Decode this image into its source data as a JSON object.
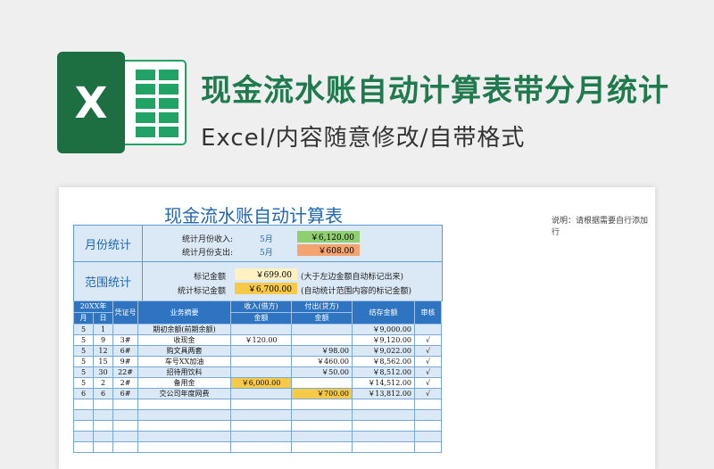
{
  "banner": {
    "title": "现金流水账自动计算表带分月统计",
    "subtitle": "Excel/内容随意修改/自带格式",
    "logo_icon": "excel-icon",
    "logo_letter": "X"
  },
  "sheet": {
    "title": "现金流水账自动计算表",
    "note": "说明：请根据需要自行添加行"
  },
  "monthly": {
    "heading": "月份统计",
    "income_label": "统计月份收入:",
    "income_month": "5月",
    "income_value": "￥6,120.00",
    "expense_label": "统计月份支出:",
    "expense_month": "5月",
    "expense_value": "￥608.00"
  },
  "range": {
    "heading": "范围统计",
    "marked_label": "标记金额",
    "marked_value": "￥699.00",
    "marked_note": "(大于左边金额自动标记出来)",
    "sum_label": "统计标记金额",
    "sum_value": "￥6,700.00",
    "sum_note": "(自动统计范围内容的标记金额)"
  },
  "ledger": {
    "header": {
      "year": "20XX年",
      "month": "月",
      "day": "日",
      "voucher": "凭证号",
      "summary": "业务摘要",
      "income": "收入(借方)",
      "income2": "金额",
      "expense": "付出(贷方)",
      "expense2": "金额",
      "balance": "结存金额",
      "audit": "审核"
    },
    "rows": [
      {
        "m": "5",
        "d": "1",
        "v": "",
        "s": "期初余额(前期余额)",
        "inc": "",
        "exp": "",
        "bal": "￥9,000.00",
        "a": ""
      },
      {
        "m": "5",
        "d": "9",
        "v": "3#",
        "s": "收现金",
        "inc": "￥120.00",
        "exp": "",
        "bal": "￥9,120.00",
        "a": "√"
      },
      {
        "m": "5",
        "d": "12",
        "v": "6#",
        "s": "购文具两套",
        "inc": "",
        "exp": "￥98.00",
        "bal": "￥9,022.00",
        "a": "√"
      },
      {
        "m": "5",
        "d": "15",
        "v": "9#",
        "s": "车号XX加油",
        "inc": "",
        "exp": "￥460.00",
        "bal": "￥8,562.00",
        "a": "√"
      },
      {
        "m": "5",
        "d": "30",
        "v": "22#",
        "s": "招待用饮料",
        "inc": "",
        "exp": "￥50.00",
        "bal": "￥8,512.00",
        "a": "√"
      },
      {
        "m": "5",
        "d": "2",
        "v": "2#",
        "s": "备用金",
        "inc": "￥6,000.00",
        "exp": "",
        "bal": "￥14,512.00",
        "a": "√"
      },
      {
        "m": "6",
        "d": "6",
        "v": "6#",
        "s": "交公司年度网费",
        "inc": "",
        "exp": "￥700.00",
        "bal": "￥13,812.00",
        "a": "√"
      }
    ],
    "highlight": [
      "5-inc",
      "6-exp"
    ]
  },
  "colors": {
    "brand_green": "#1f7a4d",
    "header_blue": "#2e74c0",
    "row_blue": "#dbe8f5",
    "income_green": "#8fcf6f",
    "expense_orange": "#f4a470",
    "marked_yellow": "#fff1c2",
    "sum_yellow": "#f7c948"
  }
}
